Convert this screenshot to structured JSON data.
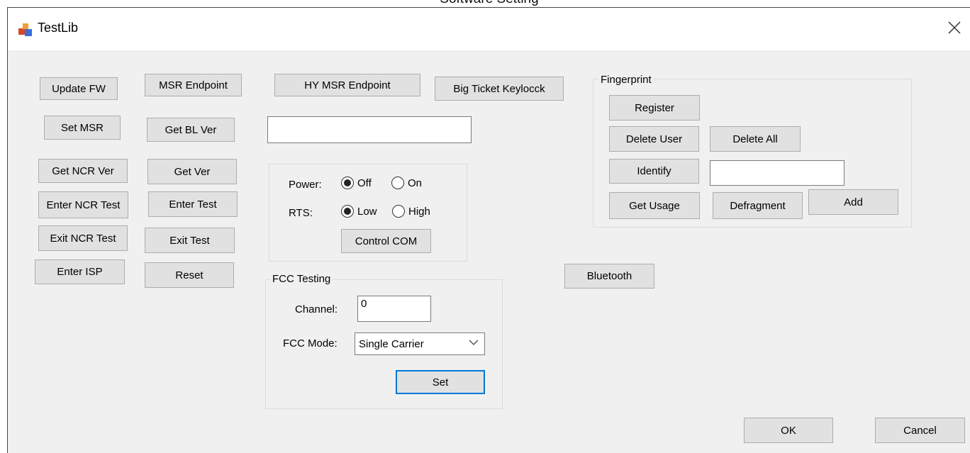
{
  "background_window": {
    "title": "Software Setting"
  },
  "window": {
    "title": "TestLib",
    "close_icon": "close-icon",
    "app_icon": "app-icon"
  },
  "left_buttons": {
    "update_fw": "Update FW",
    "msr_endpoint": "MSR Endpoint",
    "hy_msr_endpoint": "HY MSR Endpoint",
    "big_ticket_keylock": "Big Ticket Keylocck",
    "set_msr": "Set MSR",
    "get_bl_ver": "Get BL Ver",
    "get_ncr_ver": "Get NCR Ver",
    "get_ver": "Get Ver",
    "enter_ncr_test": "Enter NCR Test",
    "enter_test": "Enter Test",
    "exit_ncr_test": "Exit NCR Test",
    "exit_test": "Exit Test",
    "enter_isp": "Enter ISP",
    "reset": "Reset"
  },
  "version_output": {
    "value": ""
  },
  "com_control": {
    "power_label": "Power:",
    "power_off": "Off",
    "power_on": "On",
    "power_selected": "Off",
    "rts_label": "RTS:",
    "rts_low": "Low",
    "rts_high": "High",
    "rts_selected": "Low",
    "control_com": "Control COM"
  },
  "fcc": {
    "legend": "FCC Testing",
    "channel_label": "Channel:",
    "channel_value": "0",
    "mode_label": "FCC Mode:",
    "mode_value": "Single Carrier",
    "set": "Set"
  },
  "bluetooth": "Bluetooth",
  "fingerprint": {
    "legend": "Fingerprint",
    "register": "Register",
    "delete_user": "Delete User",
    "delete_all": "Delete All",
    "identify": "Identify",
    "identify_value": "",
    "get_usage": "Get Usage",
    "defragment": "Defragment",
    "add": "Add"
  },
  "footer": {
    "ok": "OK",
    "cancel": "Cancel"
  }
}
